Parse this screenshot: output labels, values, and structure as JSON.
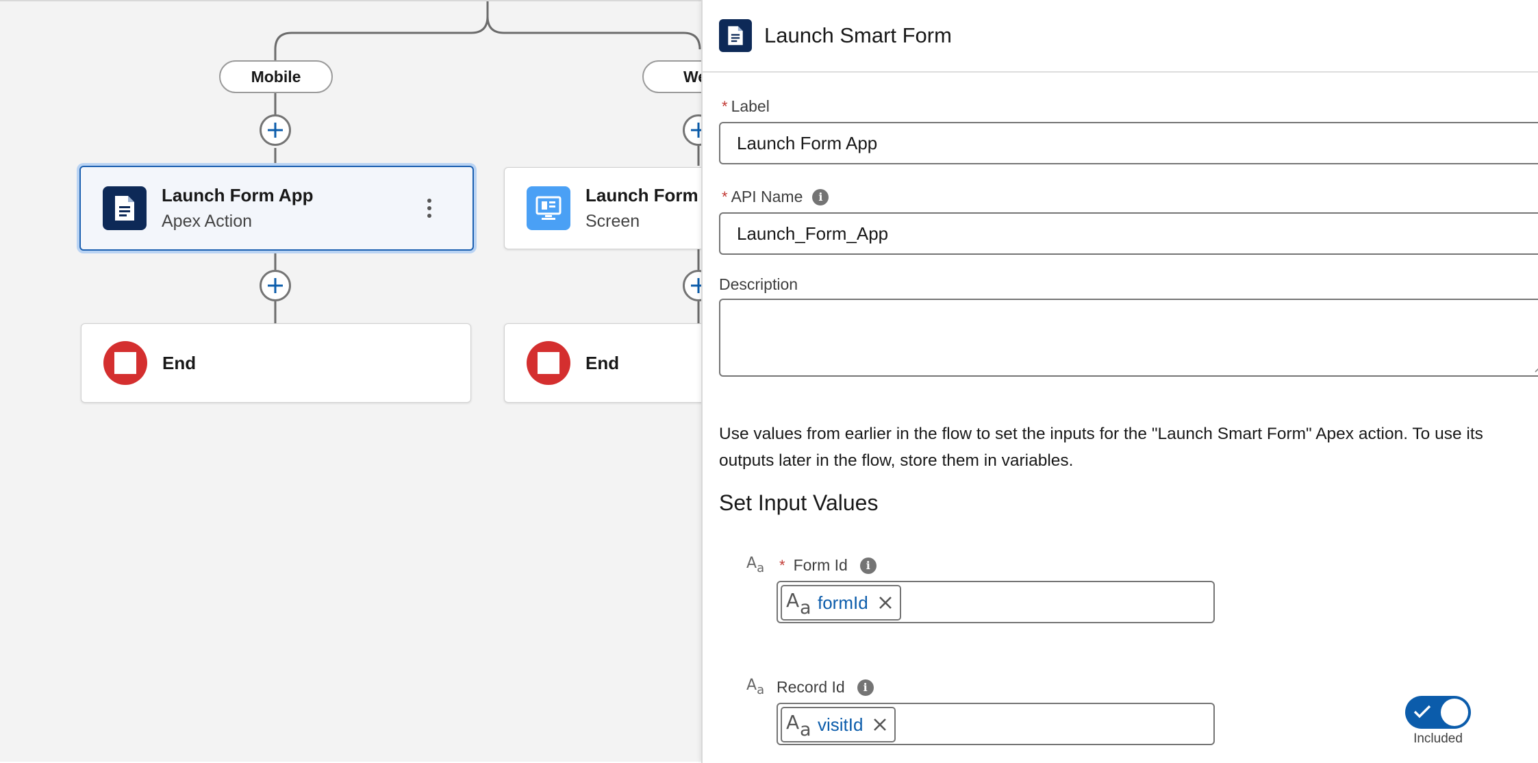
{
  "canvas": {
    "branches": [
      {
        "label": "Mobile"
      },
      {
        "label": "We"
      }
    ],
    "nodes": {
      "launch_form_app": {
        "title": "Launch Form App",
        "subtitle": "Apex Action"
      },
      "launch_form_screen": {
        "title": "Launch Form",
        "subtitle": "Screen"
      },
      "end_left": {
        "title": "End"
      },
      "end_right": {
        "title": "End"
      }
    }
  },
  "panel": {
    "title": "Launch Smart Form",
    "label_field": {
      "label": "Label",
      "required_marker": "*",
      "value": "Launch Form App"
    },
    "api_name_field": {
      "label": "API Name",
      "required_marker": "*",
      "value": "Launch_Form_App"
    },
    "description_field": {
      "label": "Description",
      "value": ""
    },
    "help_text": "Use values from earlier in the flow to set the inputs for the \"Launch Smart Form\" Apex action. To use its outputs later in the flow, store them in variables.",
    "section_title": "Set Input Values",
    "inputs": [
      {
        "label": "Form Id",
        "required_marker": "*",
        "token": "formId"
      },
      {
        "label": "Record Id",
        "token": "visitId",
        "toggle_label": "Included",
        "toggle_on": true
      }
    ]
  },
  "colors": {
    "accent": "#0b5cab",
    "selection": "#1b5fb0",
    "apex_icon_bg": "#0d2957",
    "screen_icon_bg": "#4aa0f5",
    "end_icon": "#d42f2f"
  }
}
